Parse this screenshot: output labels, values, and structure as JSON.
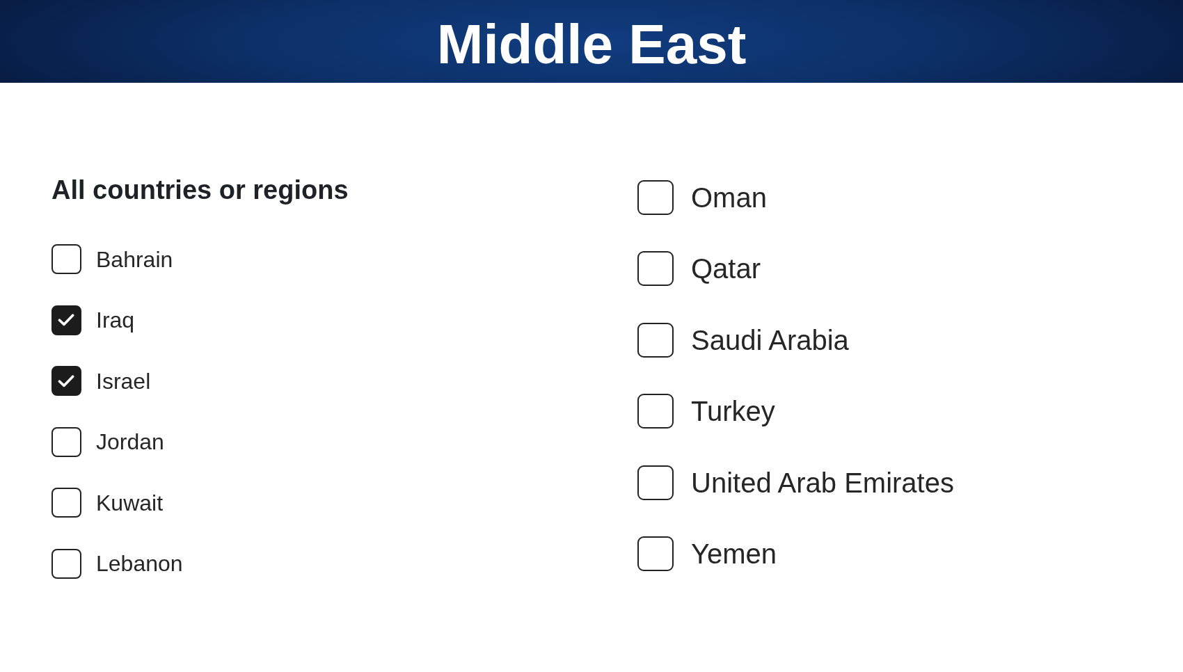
{
  "header": {
    "title": "Middle East"
  },
  "columns": [
    {
      "heading": "All countries or regions",
      "options": [
        {
          "label": "Bahrain",
          "checked": false
        },
        {
          "label": "Iraq",
          "checked": true
        },
        {
          "label": "Israel",
          "checked": true
        },
        {
          "label": "Jordan",
          "checked": false
        },
        {
          "label": "Kuwait",
          "checked": false
        },
        {
          "label": "Lebanon",
          "checked": false
        }
      ]
    },
    {
      "options": [
        {
          "label": "Oman",
          "checked": false
        },
        {
          "label": "Qatar",
          "checked": false
        },
        {
          "label": "Saudi Arabia",
          "checked": false
        },
        {
          "label": "Turkey",
          "checked": false
        },
        {
          "label": "United Arab Emirates",
          "checked": false
        },
        {
          "label": "Yemen",
          "checked": false
        }
      ]
    }
  ]
}
